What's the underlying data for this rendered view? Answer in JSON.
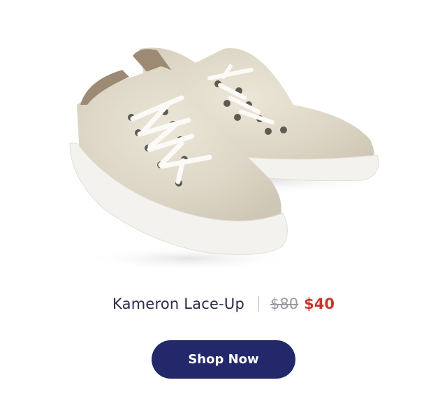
{
  "product": {
    "name": "Kameron Lace-Up",
    "original_price": "$80",
    "sale_price": "$40",
    "image_icon": "sneakers-image"
  },
  "cta": {
    "label": "Shop Now"
  },
  "colors": {
    "button": "#22286a",
    "sale_price": "#c7372b",
    "name": "#2a2d4a"
  }
}
